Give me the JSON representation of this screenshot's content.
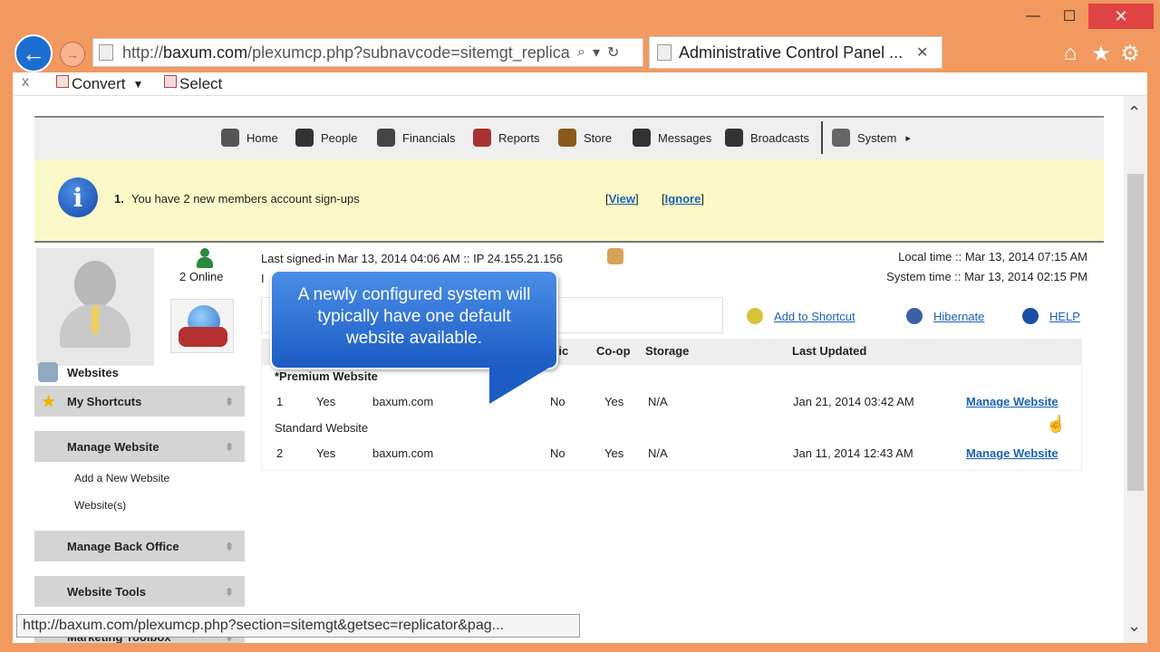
{
  "window": {
    "minimize_glyph": "—",
    "maximize_glyph": "☐",
    "close_glyph": "✕"
  },
  "browser": {
    "url_prefix": "http://",
    "url_host": "baxum.com",
    "url_path": "/plexumcp.php?subnavcode=sitemgt_replica",
    "tab_title": "Administrative Control Panel ...",
    "tab_close": "✕",
    "search_icon": "⌕",
    "dropdown_icon": "▾",
    "refresh_icon": "↻",
    "home_icon": "⌂",
    "favorites_icon": "★",
    "settings_icon": "⚙"
  },
  "commandbar": {
    "close": "x",
    "convert": "Convert",
    "convert_caret": "▼",
    "select": "Select"
  },
  "topnav": {
    "items": [
      {
        "label": "Home",
        "icon": "home-icon",
        "color": "#555555"
      },
      {
        "label": "People",
        "icon": "people-icon",
        "color": "#333333"
      },
      {
        "label": "Financials",
        "icon": "financials-icon",
        "color": "#444444"
      },
      {
        "label": "Reports",
        "icon": "reports-icon",
        "color": "#a83232"
      },
      {
        "label": "Store",
        "icon": "store-icon",
        "color": "#8a5a1c"
      },
      {
        "label": "Messages",
        "icon": "messages-icon",
        "color": "#333333"
      },
      {
        "label": "Broadcasts",
        "icon": "broadcasts-icon",
        "color": "#333333"
      },
      {
        "label": "System",
        "icon": "system-icon",
        "color": "#666666"
      }
    ],
    "system_arrow": "▸"
  },
  "notice": {
    "number": "1.",
    "text": "You have 2 new members account sign-ups",
    "view_label": "View",
    "ignore_label": "Ignore",
    "bracket_open": "[",
    "bracket_close": "]"
  },
  "sidebar": {
    "online_text": "2 Online",
    "section_title": "Websites",
    "shortcuts_label": "My Shortcuts",
    "manage_website_label": "Manage Website",
    "add_website_label": "Add a New Website",
    "websites_label": "Website(s)",
    "back_office_label": "Manage Back Office",
    "tools_label": "Website Tools",
    "marketing_label": "Marketing Toolbox",
    "grip": "⇞"
  },
  "main": {
    "last_signed_in": "Last signed-in Mar 13, 2014 04:06 AM :: IP 24.155.21.156",
    "ip_stub": "I",
    "local_time": "Local time :: Mar 13, 2014 07:15 AM",
    "system_time": "System time :: Mar 13, 2014 02:15 PM",
    "actions": {
      "shortcut": "Add to Shortcut",
      "hibernate": "Hibernate",
      "help": "HELP"
    }
  },
  "table": {
    "headers": {
      "tic": "tic",
      "coop": "Co-op",
      "storage": "Storage",
      "updated": "Last Updated"
    },
    "groups": {
      "premium": "*Premium Website",
      "standard": "Standard Website"
    },
    "rows": [
      {
        "num": "1",
        "active": "Yes",
        "domain": "baxum.com",
        "tic": "No",
        "coop": "Yes",
        "storage": "N/A",
        "updated": "Jan 21, 2014 03:42 AM",
        "action": "Manage Website"
      },
      {
        "num": "2",
        "active": "Yes",
        "domain": "baxum.com",
        "tic": "No",
        "coop": "Yes",
        "storage": "N/A",
        "updated": "Jan 11, 2014 12:43 AM",
        "action": "Manage Website"
      }
    ]
  },
  "callout": {
    "line1": "A newly configured system will",
    "line2": "typically  have one default",
    "line3": "website available."
  },
  "statusbar": {
    "text": "http://baxum.com/plexumcp.php?section=sitemgt&getsec=replicator&pag..."
  },
  "scroll": {
    "up": "⌃",
    "down": "⌄"
  }
}
